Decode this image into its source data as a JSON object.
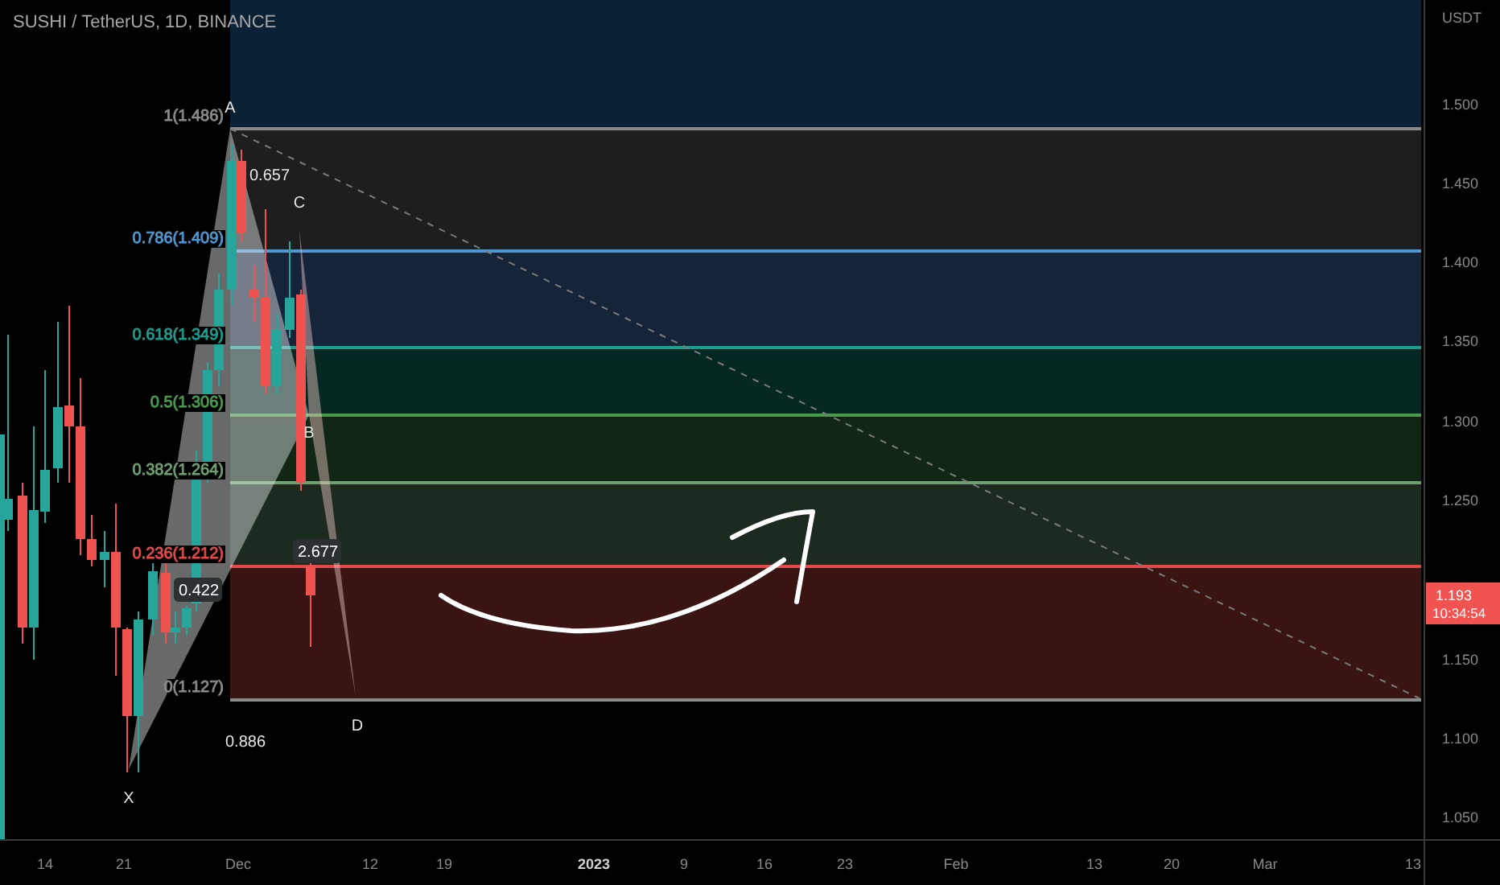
{
  "chart_title": "SUSHI / TetherUS, 1D, BINANCE",
  "currency": "USDT",
  "fib_levels": [
    {
      "label": "1(1.486)",
      "color": "#8a8a8a"
    },
    {
      "label": "0.786(1.409)",
      "color": "#4f97d1"
    },
    {
      "label": "0.618(1.349)",
      "color": "#1e9c8e"
    },
    {
      "label": "0.5(1.306)",
      "color": "#4a9a4e"
    },
    {
      "label": "0.382(1.264)",
      "color": "#6f9f72"
    },
    {
      "label": "0.236(1.212)",
      "color": "#e04a4a"
    },
    {
      "label": "0(1.127)",
      "color": "#8a8a8a"
    }
  ],
  "pattern_points": [
    {
      "label": "X"
    },
    {
      "label": "A"
    },
    {
      "label": "B"
    },
    {
      "label": "C"
    },
    {
      "label": "D"
    }
  ],
  "pattern_ratios": [
    {
      "label": "0.657",
      "boxed": false
    },
    {
      "label": "0.422",
      "boxed": true
    },
    {
      "label": "2.677",
      "boxed": true
    },
    {
      "label": "0.886",
      "boxed": false
    }
  ],
  "price_axis": [
    "1.500",
    "1.450",
    "1.400",
    "1.350",
    "1.300",
    "1.250",
    "1.150",
    "1.100",
    "1.050"
  ],
  "time_axis": [
    {
      "label": "14",
      "emphasis": false
    },
    {
      "label": "21",
      "emphasis": false
    },
    {
      "label": "Dec",
      "emphasis": false
    },
    {
      "label": "12",
      "emphasis": false
    },
    {
      "label": "19",
      "emphasis": false
    },
    {
      "label": "2023",
      "emphasis": true
    },
    {
      "label": "9",
      "emphasis": false
    },
    {
      "label": "16",
      "emphasis": false
    },
    {
      "label": "23",
      "emphasis": false
    },
    {
      "label": "Feb",
      "emphasis": false
    },
    {
      "label": "13",
      "emphasis": false
    },
    {
      "label": "20",
      "emphasis": false
    },
    {
      "label": "Mar",
      "emphasis": false
    },
    {
      "label": "13",
      "emphasis": false
    }
  ],
  "last_price": {
    "price": "1.193",
    "countdown": "10:34:54"
  }
}
